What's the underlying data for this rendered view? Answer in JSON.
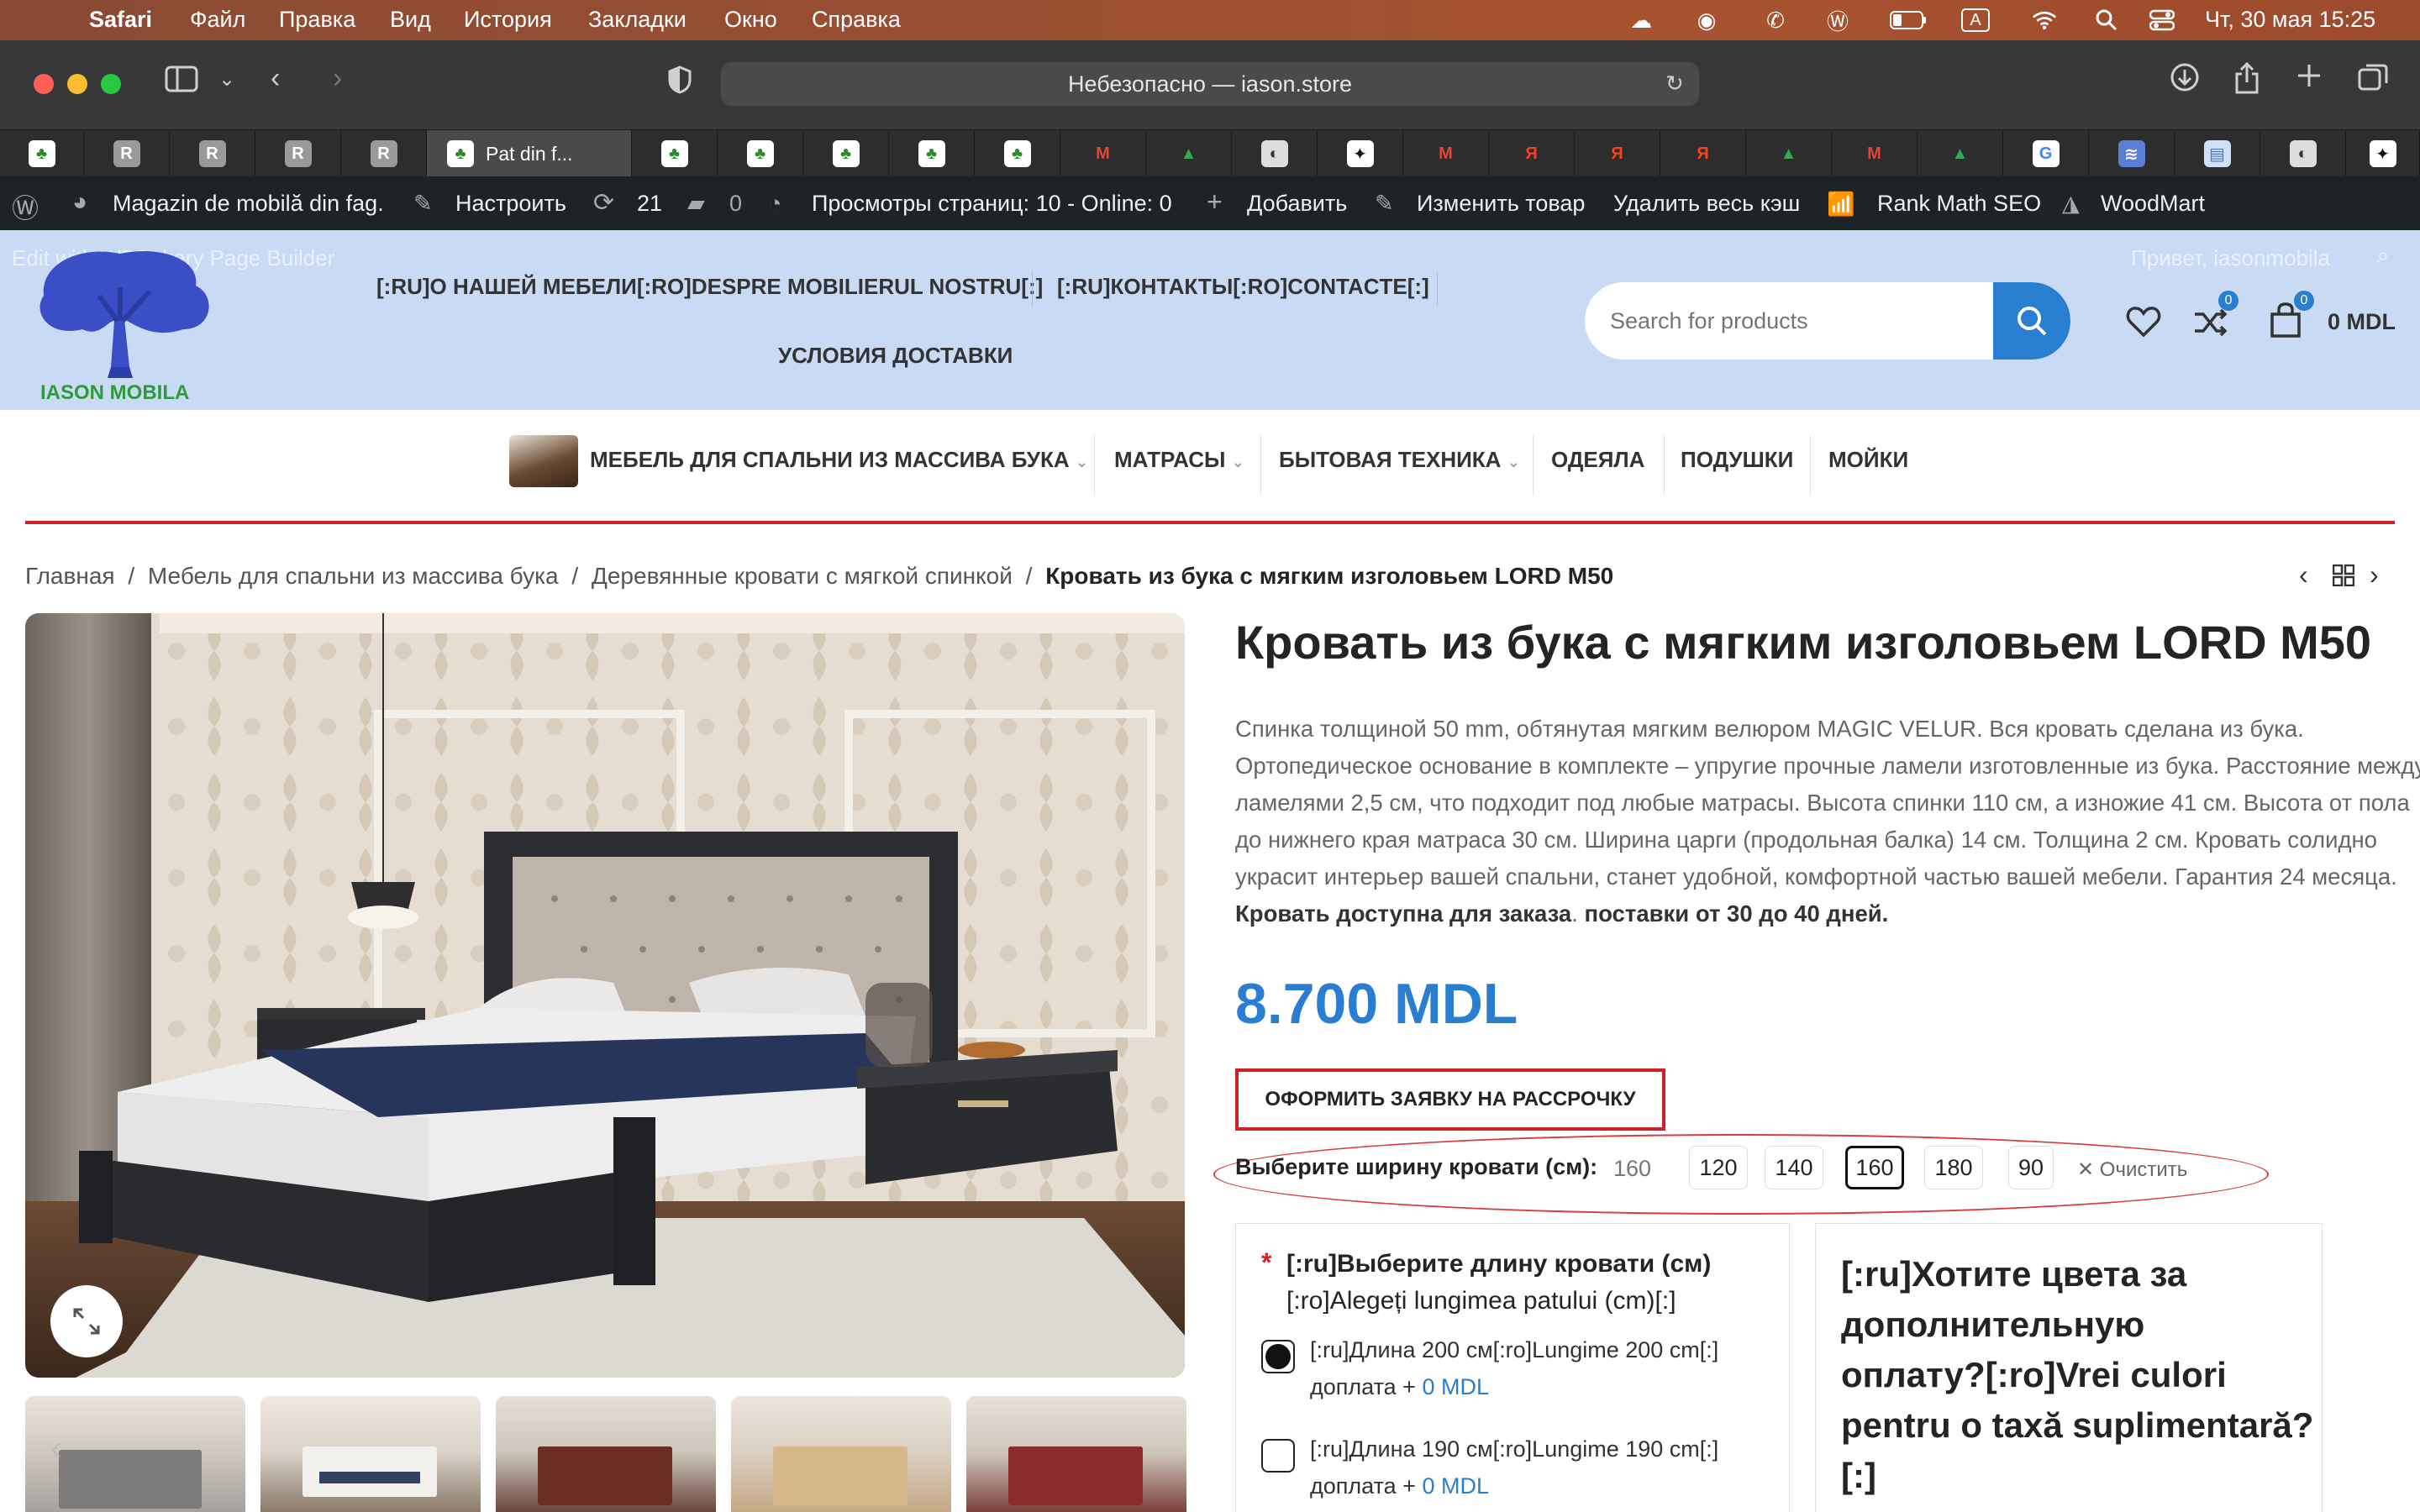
{
  "menubar": {
    "app": "Safari",
    "items": [
      "Файл",
      "Правка",
      "Вид",
      "История",
      "Закладки",
      "Окно",
      "Справка"
    ],
    "datetime": "Чт, 30 мая  15:25",
    "input_indicator": "A"
  },
  "browser": {
    "address": "Небезопасно — iason.store",
    "active_tab": "Pat din f..."
  },
  "wpbar": {
    "site": "Magazin de mobilă din fag.",
    "customize": "Настроить",
    "updates": "21",
    "comments": "0",
    "views": "Просмотры страниц: 10 - Online: 0",
    "add": "Добавить",
    "edit": "Изменить товар",
    "clear_cache": "Удалить весь кэш",
    "rankmath": "Rank Math SEO",
    "woodmart": "WoodMart"
  },
  "header": {
    "wpbakery": "Edit with WPBakery Page Builder",
    "greeting": "Привет, iasonmobila",
    "logo_text": "IASON MOBILA",
    "links": [
      "[:RU]О НАШЕЙ МЕБЕЛИ[:RO]DESPRE MOBILIERUL NOSTRU[:]",
      "[:RU]КОНТАКТЫ[:RO]CONTACTE[:]",
      "УСЛОВИЯ ДОСТАВКИ"
    ],
    "search_placeholder": "Search for products",
    "wishlist_count": "0",
    "compare_count": "0",
    "cart_count": "0",
    "cart_total": "0 MDL"
  },
  "nav": {
    "items": [
      "МЕБЕЛЬ ДЛЯ СПАЛЬНИ ИЗ МАССИВА БУКА",
      "МАТРАСЫ",
      "БЫТОВАЯ ТЕХНИКА",
      "ОДЕЯЛА",
      "ПОДУШКИ",
      "МОЙКИ"
    ]
  },
  "breadcrumb": {
    "items": [
      "Главная",
      "Мебель для спальни из массива бука",
      "Деревянные кровати с мягкой спинкой"
    ],
    "current": "Кровать из бука с мягким изголовьем LORD M50"
  },
  "product": {
    "title": "Кровать из бука с мягким изголовьем LORD M50",
    "description": "Спинка толщиной 50 mm, обтянутая мягким велюром MAGIC VELUR.  Вся кровать сделана из бука. Ортопедическое основание в комплекте – упругие прочные ламели изготовленные из бука. Расстояние между ламелями 2,5 см, что подходит под любые матрасы. Высота спинки 110 см, а изножие 41 см. Высота от пола до нижнего края матраса 30 см. Ширина царги (продольная балка) 14 см. Толщина 2 см.  Кровать солидно украсит интерьер вашей спальни, станет удобной, комфортной частью вашей мебели.  Гарантия 24 месяца.",
    "availability": "Кровать доступна для заказа",
    "delivery": "поставки от 30 до 40 дней.",
    "price": "8.700 MDL",
    "installment_button": "ОФОРМИТЬ ЗАЯВКУ НА РАССРОЧКУ",
    "width_label": "Выберите ширину кровати (см)",
    "width_selected": "160",
    "widths": [
      "120",
      "140",
      "160",
      "180",
      "90"
    ],
    "clear": "Очистить"
  },
  "options": {
    "length_title_ru": "[:ru]Выберите длину кровати (см)",
    "length_title_ro": "[:ro]Alegeți lungimea patului (cm)[:]",
    "length_options": [
      {
        "label": "[:ru]Длина 200 см[:ro]Lungime 200 cm[:]",
        "extra": "доплата +",
        "price": "0 MDL",
        "selected": true
      },
      {
        "label": "[:ru]Длина 190 см[:ro]Lungime 190 cm[:]",
        "extra": "доплата +",
        "price": "0 MDL",
        "selected": false
      }
    ],
    "color_title": [
      "[:ru]Хотите цвета за",
      "дополнительную",
      "оплату?[:ro]Vrei culori",
      "pentru o taxă suplimentară?",
      "[:]"
    ]
  },
  "colors": {
    "accent": "#2a7ed2",
    "brand_red": "#d11f25",
    "header_bg": "#c8daf4"
  }
}
